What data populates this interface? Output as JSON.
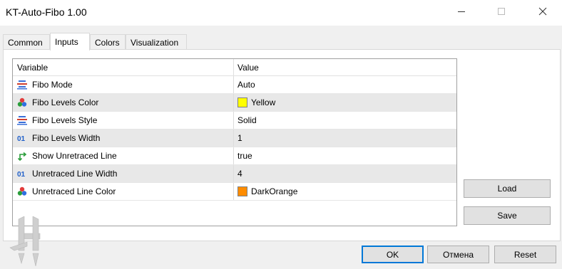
{
  "window": {
    "title": "KT-Auto-Fibo 1.00"
  },
  "tabs": [
    {
      "label": "Common",
      "active": false
    },
    {
      "label": "Inputs",
      "active": true
    },
    {
      "label": "Colors",
      "active": false
    },
    {
      "label": "Visualization",
      "active": false
    }
  ],
  "grid": {
    "header": {
      "variable": "Variable",
      "value": "Value"
    },
    "rows": [
      {
        "label": "Fibo Mode",
        "value": "Auto",
        "icon": "enum-icon"
      },
      {
        "label": "Fibo Levels Color",
        "value": "Yellow",
        "icon": "color-icon",
        "swatch": "#ffff00"
      },
      {
        "label": "Fibo Levels Style",
        "value": "Solid",
        "icon": "enum-icon"
      },
      {
        "label": "Fibo Levels Width",
        "value": "1",
        "icon": "integer-icon"
      },
      {
        "label": "Show Unretraced Line",
        "value": "true",
        "icon": "bool-icon"
      },
      {
        "label": "Unretraced Line Width",
        "value": "4",
        "icon": "integer-icon"
      },
      {
        "label": "Unretraced Line Color",
        "value": "DarkOrange",
        "icon": "color-icon",
        "swatch": "#ff8c00"
      }
    ]
  },
  "side_buttons": {
    "load": "Load",
    "save": "Save"
  },
  "footer": {
    "ok": "OK",
    "cancel": "Отмена",
    "reset": "Reset"
  },
  "colors": {
    "accent": "#0078d7",
    "enum_icon": "#3a6fd8",
    "integer_icon": "#1f5fc9",
    "bool_icon": "#2a9d3a"
  }
}
